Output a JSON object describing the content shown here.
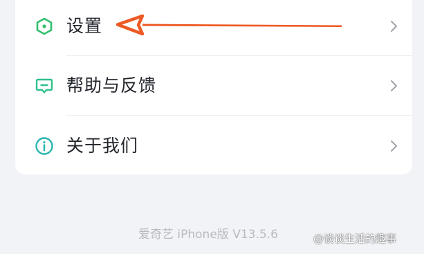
{
  "menu": {
    "items": [
      {
        "label": "设置",
        "icon": "settings-hexagon-icon",
        "icon_color": "#2fc06a",
        "chevron": "chevron-right-icon"
      },
      {
        "label": "帮助与反馈",
        "icon": "feedback-chat-icon",
        "icon_color": "#2fc08a",
        "chevron": "chevron-right-icon"
      },
      {
        "label": "关于我们",
        "icon": "info-icon",
        "icon_color": "#2ab6b0",
        "chevron": "chevron-right-icon"
      }
    ]
  },
  "annotation": {
    "icon": "orange-arrow-annotation",
    "color": "#ee5a24"
  },
  "footer": {
    "version_text": "爱奇艺 iPhone版 V13.5.6"
  },
  "watermark": {
    "text": "@谈谈生活的趣事"
  },
  "colors": {
    "background": "#f2f3f7",
    "card": "#ffffff",
    "text": "#22252b",
    "footer_text": "#b8bac0",
    "chevron": "#a0a3aa"
  }
}
